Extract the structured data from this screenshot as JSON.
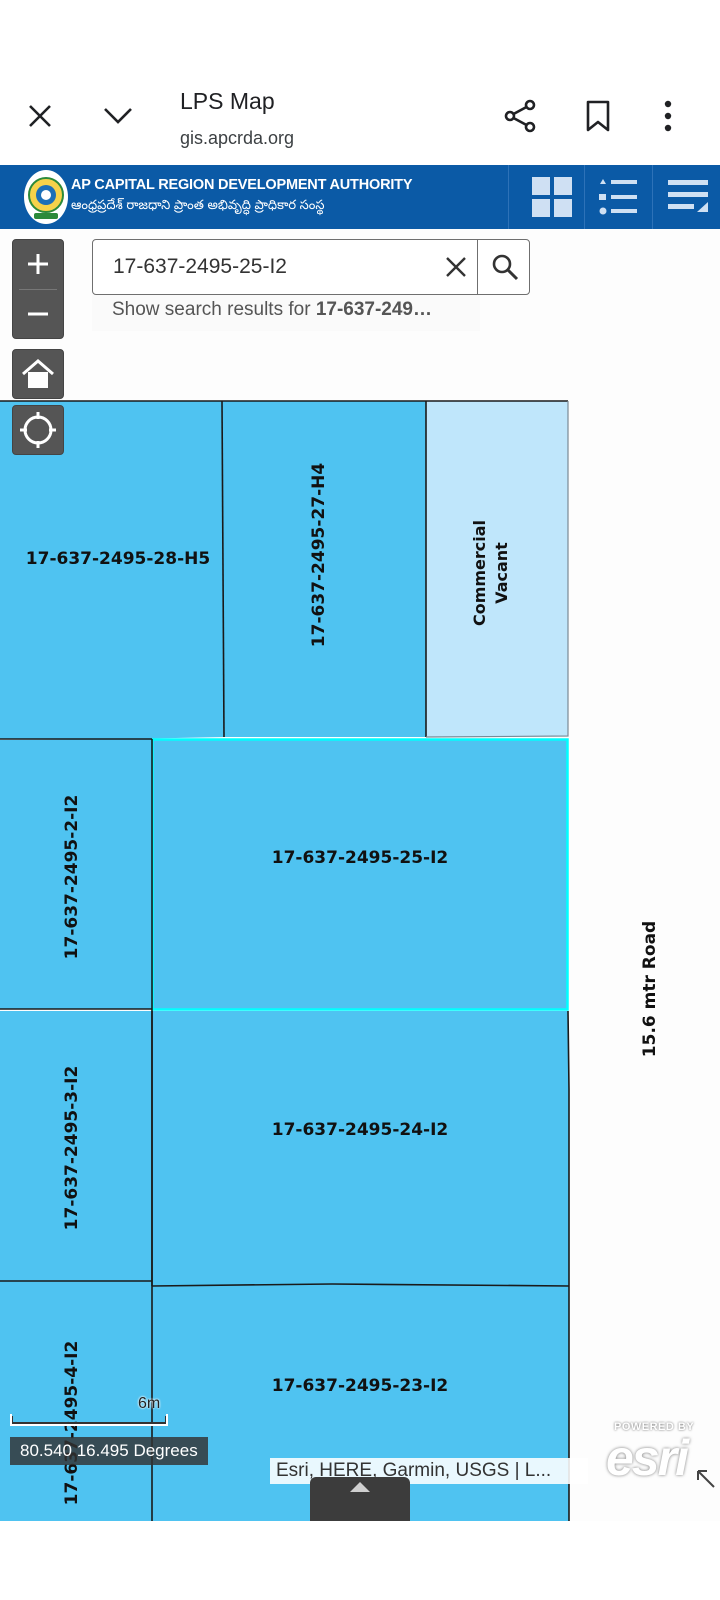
{
  "browser": {
    "title": "LPS Map",
    "url": "gis.apcrda.org"
  },
  "header": {
    "title_en": "AP CAPITAL REGION DEVELOPMENT AUTHORITY",
    "title_te": "ఆంధ్రప్రదేశ్ రాజధాని ప్రాంత అభివృద్ధి ప్రాధికార సంస్థ"
  },
  "search": {
    "value": "17-637-2495-25-I2",
    "suggestion_prefix": "Show search results for ",
    "suggestion_term": "17-637-249…"
  },
  "map": {
    "parcels": [
      {
        "label": "17-637-2495-28-H5"
      },
      {
        "label": "17-637-2495-27-H4"
      },
      {
        "label": "Commercial"
      },
      {
        "label": "Vacant"
      },
      {
        "label": "17-637-2495-2-I2"
      },
      {
        "label": "17-637-2495-25-I2"
      },
      {
        "label": "17-637-2495-3-I2"
      },
      {
        "label": "17-637-2495-24-I2"
      },
      {
        "label": "17-637-2495-4-I2"
      },
      {
        "label": "17-637-2495-23-I2"
      }
    ],
    "road_label": "15.6 mtr Road",
    "scale_label": "6m",
    "coordinates": "80.540 16.495 Degrees",
    "attribution": "Esri, HERE, Garmin, USGS | L...",
    "esri_powered_by": "POWERED BY",
    "esri_word": "esri",
    "colors": {
      "parcel_fill": "#4fc3f1",
      "commercial_fill": "#bfe6fb",
      "selected_outline": "#00ffff",
      "header_bg": "#0b5aa6"
    }
  }
}
